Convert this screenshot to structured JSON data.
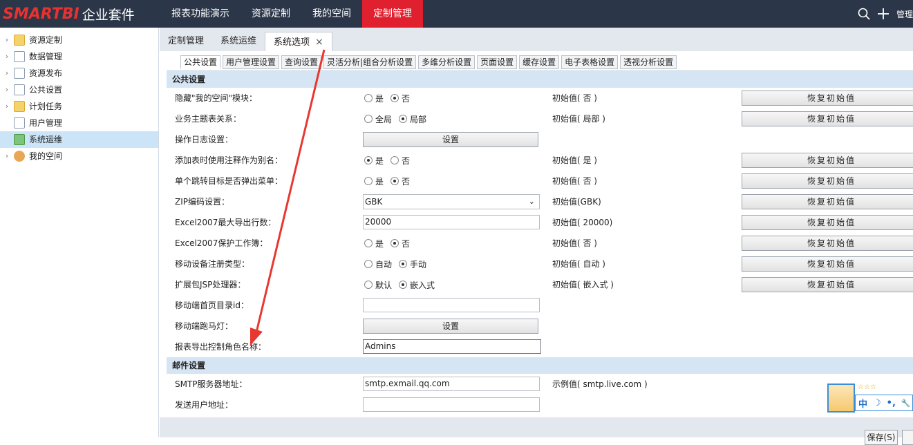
{
  "brand": {
    "logo": "SMARTBI",
    "suite": "企业套件"
  },
  "nav": [
    {
      "label": "报表功能演示",
      "active": false
    },
    {
      "label": "资源定制",
      "active": false
    },
    {
      "label": "我的空间",
      "active": false
    },
    {
      "label": "定制管理",
      "active": true
    }
  ],
  "top_right": {
    "admin_label": "管理"
  },
  "sidebar": {
    "items": [
      {
        "label": "资源定制",
        "icon": "folder-icon",
        "expandable": true
      },
      {
        "label": "数据管理",
        "icon": "document-icon",
        "expandable": true
      },
      {
        "label": "资源发布",
        "icon": "edit-document-icon",
        "expandable": true
      },
      {
        "label": "公共设置",
        "icon": "settings-document-icon",
        "expandable": true
      },
      {
        "label": "计划任务",
        "icon": "task-icon",
        "expandable": true
      },
      {
        "label": "用户管理",
        "icon": "user-management-icon",
        "expandable": false
      },
      {
        "label": "系统运维",
        "icon": "system-ops-icon",
        "expandable": false,
        "selected": true
      },
      {
        "label": "我的空间",
        "icon": "user-icon",
        "expandable": true
      }
    ]
  },
  "tabs": [
    {
      "label": "定制管理",
      "active": false
    },
    {
      "label": "系统运维",
      "active": false
    },
    {
      "label": "系统选项",
      "active": true,
      "close": "×"
    }
  ],
  "subtabs": [
    {
      "label": "公共设置",
      "active": true
    },
    {
      "label": "用户管理设置"
    },
    {
      "label": "查询设置"
    },
    {
      "label": "灵活分析|组合分析设置"
    },
    {
      "label": "多维分析设置"
    },
    {
      "label": "页面设置"
    },
    {
      "label": "缓存设置"
    },
    {
      "label": "电子表格设置"
    },
    {
      "label": "透视分析设置"
    }
  ],
  "sections": {
    "public": "公共设置",
    "mail": "邮件设置"
  },
  "rows": {
    "hide_myspace": {
      "label": "隐藏\"我的空间\"模块：",
      "opt1": "是",
      "opt2": "否",
      "init": "初始值( 否 )"
    },
    "biz_relation": {
      "label": "业务主题表关系：",
      "opt1": "全局",
      "opt2": "局部",
      "init": "初始值( 局部 )"
    },
    "op_log": {
      "label": "操作日志设置：",
      "button": "设置"
    },
    "alias": {
      "label": "添加表时使用注释作为别名：",
      "opt1": "是",
      "opt2": "否",
      "init": "初始值( 是 )"
    },
    "jump_menu": {
      "label": "单个跳转目标是否弹出菜单：",
      "opt1": "是",
      "opt2": "否",
      "init": "初始值( 否 )"
    },
    "zip": {
      "label": "ZIP编码设置：",
      "value": "GBK",
      "init": "初始值(GBK)"
    },
    "excel_rows": {
      "label": "Excel2007最大导出行数：",
      "value": "20000",
      "init": "初始值( 20000)"
    },
    "excel_protect": {
      "label": "Excel2007保护工作簿：",
      "opt1": "是",
      "opt2": "否",
      "init": "初始值( 否 )"
    },
    "mobile_reg": {
      "label": "移动设备注册类型：",
      "opt1": "自动",
      "opt2": "手动",
      "init": "初始值( 自动 )"
    },
    "jsp": {
      "label": "扩展包JSP处理器：",
      "opt1": "默认",
      "opt2": "嵌入式",
      "init": "初始值( 嵌入式 )"
    },
    "mobile_home": {
      "label": "移动端首页目录id：",
      "value": ""
    },
    "mobile_marquee": {
      "label": "移动端跑马灯：",
      "button": "设置"
    },
    "export_role": {
      "label": "报表导出控制角色名称：",
      "value": "Admins"
    },
    "smtp": {
      "label": "SMTP服务器地址：",
      "value": "smtp.exmail.qq.com",
      "init": "示例值( smtp.live.com )"
    },
    "sender": {
      "label": "发送用户地址：",
      "value": ""
    }
  },
  "reset_label": "恢复初始值",
  "bottom": {
    "save": "保存(S)"
  },
  "widget": {
    "stars": "☆☆☆",
    "ime_char": "中",
    "moon": "☽",
    "dots": "•,",
    "wrench": "🔧"
  },
  "colors": {
    "topbar": "#2b3648",
    "active_nav": "#e0202e",
    "brand_red": "#e8322f",
    "section": "#d6e5f3",
    "arrow": "#e8372f"
  }
}
